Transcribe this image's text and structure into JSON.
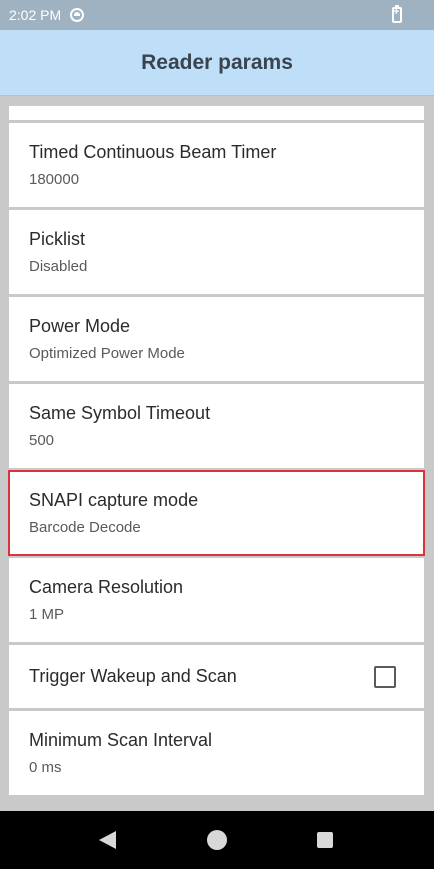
{
  "status_bar": {
    "time": "2:02 PM"
  },
  "app_bar": {
    "title": "Reader params"
  },
  "items": [
    {
      "title": "Timed Continuous Beam Timer",
      "value": "180000"
    },
    {
      "title": "Picklist",
      "value": "Disabled"
    },
    {
      "title": "Power Mode",
      "value": "Optimized Power Mode"
    },
    {
      "title": "Same Symbol Timeout",
      "value": "500"
    },
    {
      "title": "SNAPI capture mode",
      "value": "Barcode Decode"
    },
    {
      "title": "Camera Resolution",
      "value": "1 MP"
    },
    {
      "title": "Trigger Wakeup and Scan",
      "checked": false
    },
    {
      "title": "Minimum Scan Interval",
      "value": "0 ms"
    }
  ],
  "colors": {
    "app_bar": "#bfdff8",
    "highlight": "#d9343e",
    "status_bar": "#9fb2c2"
  }
}
